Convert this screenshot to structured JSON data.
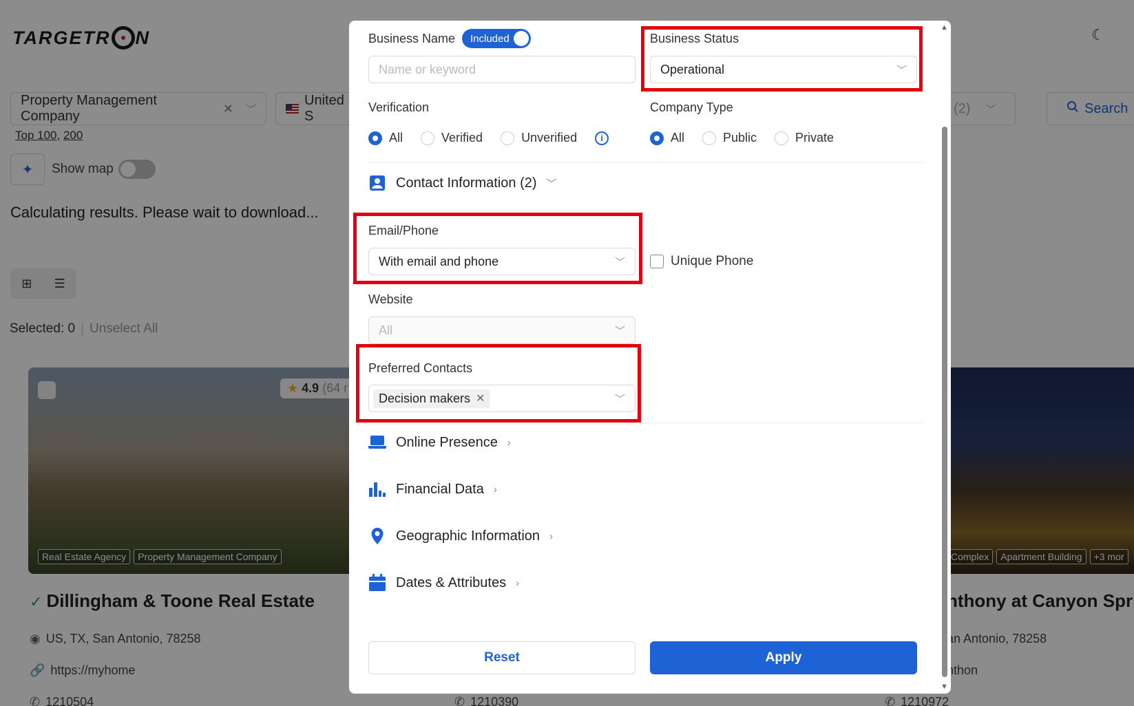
{
  "app": {
    "logo": "TARGETR",
    "logo_tail": "N"
  },
  "background": {
    "category_filter": "Property Management Company",
    "country_filter": "United S",
    "other_filter": "(2)",
    "search_label": "Search",
    "sub_links": [
      "Top 100,",
      "200"
    ],
    "show_map_label": "Show map",
    "status_text": "Calculating results. Please wait to download...",
    "selected_label": "Selected: 0",
    "unselect_label": "Unselect All",
    "card1": {
      "rating": "4.9",
      "rating_count": "(64 r",
      "tags": [
        "Real Estate Agency",
        "Property Management Company"
      ],
      "title": "Dillingham & Toone Real Estate",
      "address": "US, TX, San Antonio, 78258",
      "website": "https://myhome",
      "phone": "1210504"
    },
    "card2": {
      "tags": [
        "Complex",
        "Apartment Building",
        "+3 mor"
      ],
      "title": "nthony at Canyon Sprin",
      "address": "an Antonio, 78258",
      "website": "nthon",
      "phone": "1210972"
    },
    "card_mid_phone": "1210390"
  },
  "modal": {
    "business_name": {
      "label": "Business Name",
      "toggle_label": "Included",
      "placeholder": "Name or keyword"
    },
    "business_status": {
      "label": "Business Status",
      "value": "Operational"
    },
    "verification": {
      "label": "Verification",
      "options": [
        "All",
        "Verified",
        "Unverified"
      ],
      "selected": "All"
    },
    "company_type": {
      "label": "Company Type",
      "options": [
        "All",
        "Public",
        "Private"
      ],
      "selected": "All"
    },
    "contact_section": {
      "label": "Contact Information (2)"
    },
    "email_phone": {
      "label": "Email/Phone",
      "value": "With email and phone"
    },
    "unique_phone": {
      "label": "Unique Phone",
      "checked": false
    },
    "website": {
      "label": "Website",
      "value": "All"
    },
    "preferred_contacts": {
      "label": "Preferred Contacts",
      "tag": "Decision makers"
    },
    "sections": [
      "Online Presence",
      "Financial Data",
      "Geographic Information",
      "Dates & Attributes"
    ],
    "reset_label": "Reset",
    "apply_label": "Apply"
  },
  "colors": {
    "accent": "#1e63d6",
    "highlight": "#e3000f"
  }
}
